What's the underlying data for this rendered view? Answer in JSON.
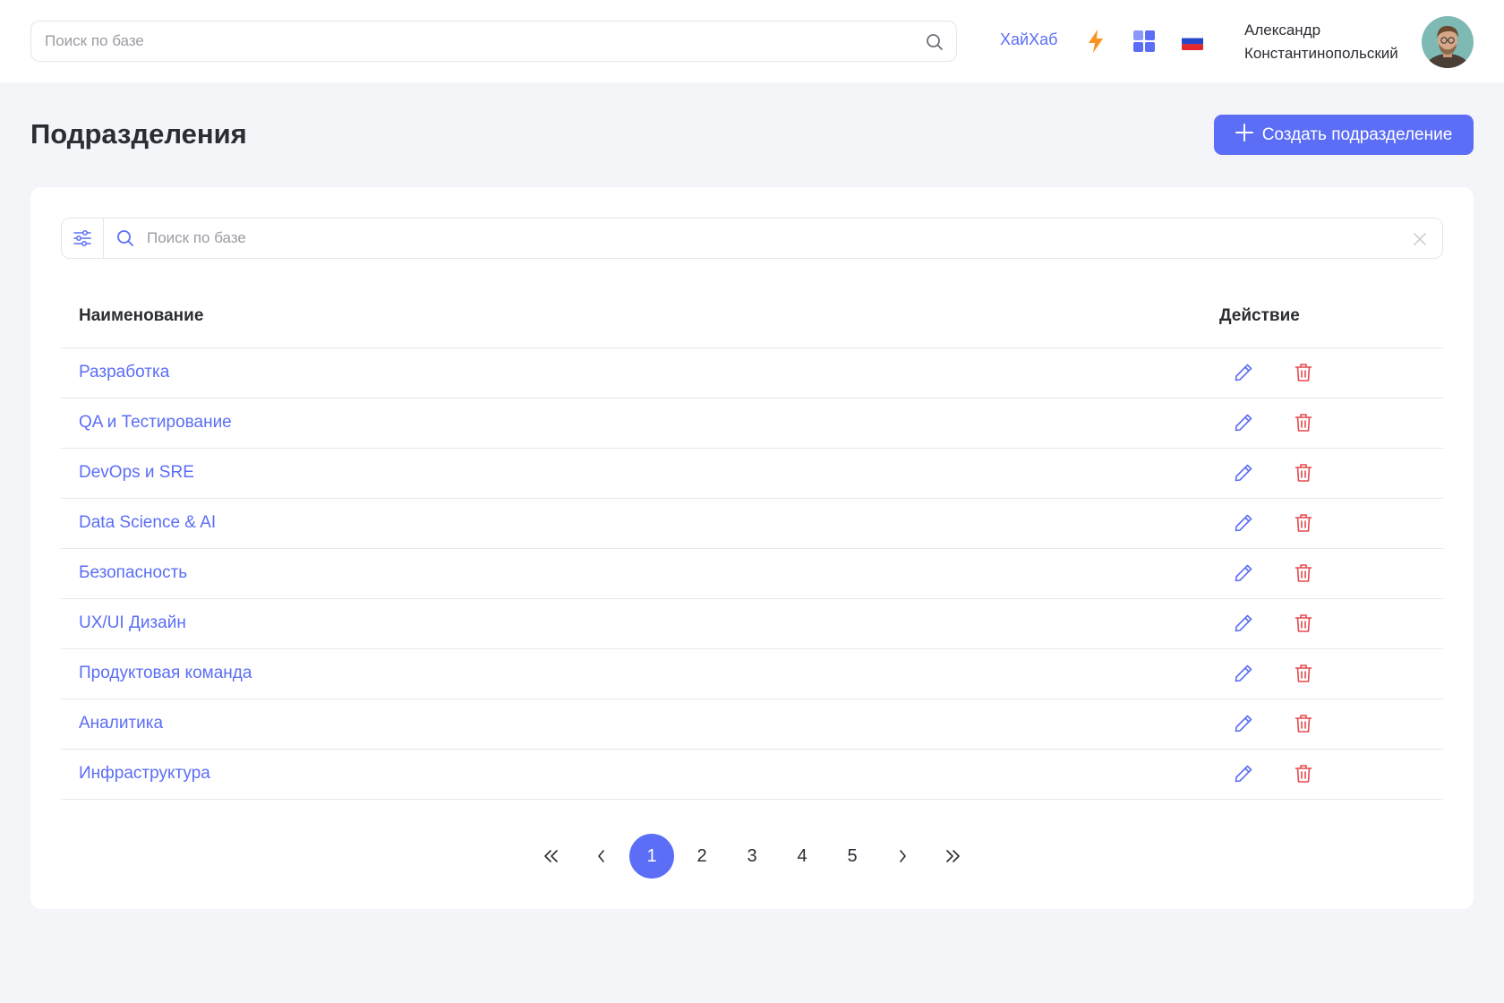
{
  "header": {
    "search_placeholder": "Поиск по базе",
    "hub_link": "ХайХаб",
    "user_name_first": "Александр",
    "user_name_last": "Константинопольский"
  },
  "page": {
    "title": "Подразделения",
    "create_button": "Создать подразделение"
  },
  "filter": {
    "search_placeholder": "Поиск по базе"
  },
  "table": {
    "columns": [
      "Наименование",
      "Действие"
    ],
    "rows": [
      "Разработка",
      "QA и Тестирование",
      "DevOps и SRE",
      "Data Science & AI",
      "Безопасность",
      "UX/UI Дизайн",
      "Продуктовая команда",
      "Аналитика",
      "Инфраструктура"
    ]
  },
  "pagination": {
    "pages": [
      "1",
      "2",
      "3",
      "4",
      "5"
    ],
    "current": "1"
  },
  "colors": {
    "accent": "#5b6ef5",
    "danger": "#e5484d",
    "bolt": "#f7931e"
  }
}
